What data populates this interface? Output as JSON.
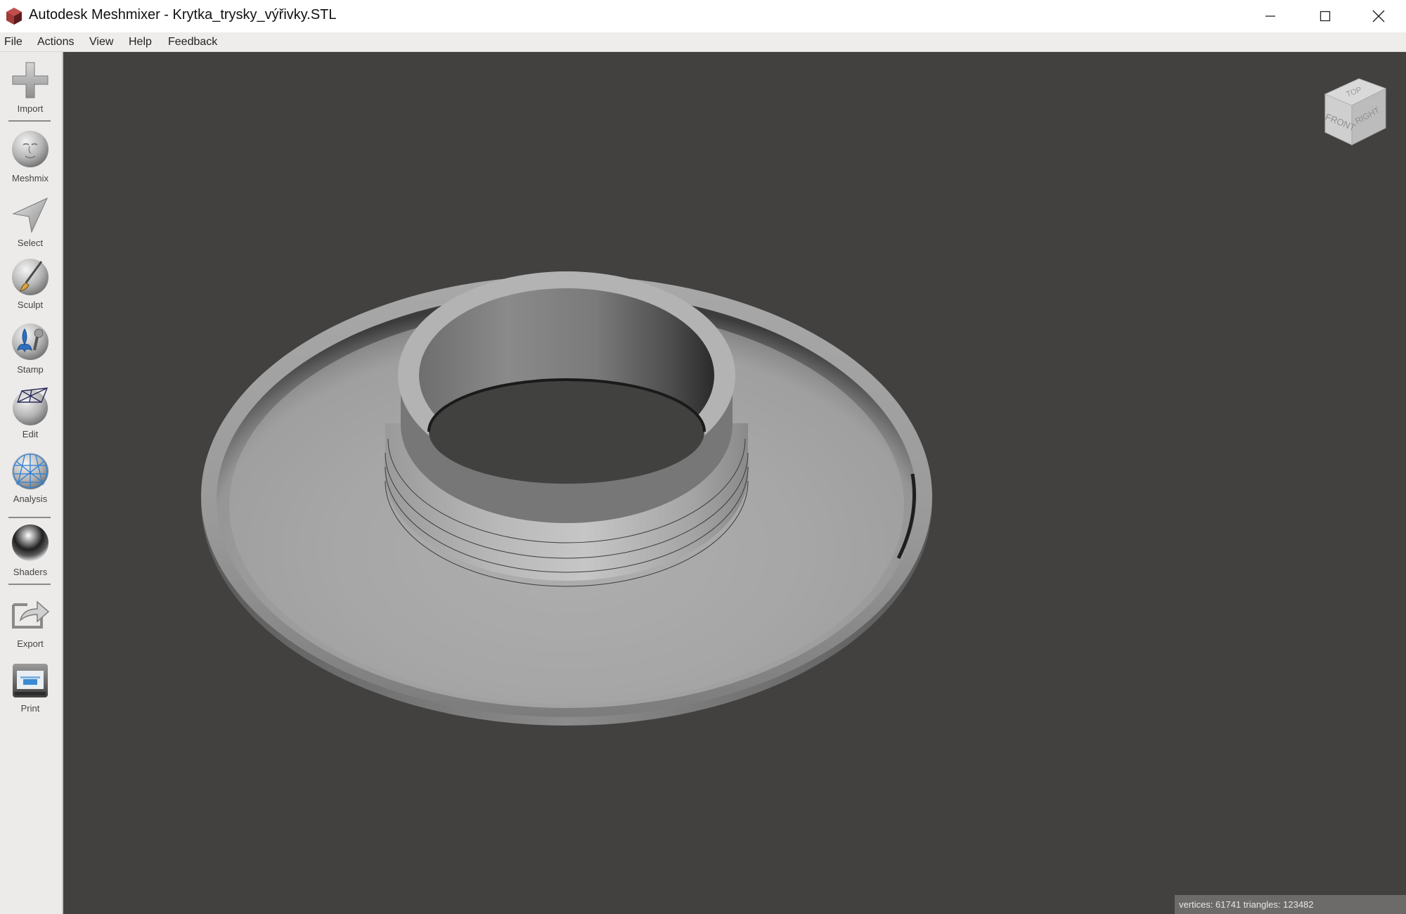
{
  "window": {
    "title": "Autodesk Meshmixer - Krytka_trysky_výřivky.STL",
    "controls": {
      "minimize": "minimize-icon",
      "maximize": "maximize-icon",
      "close": "close-icon"
    }
  },
  "menu": {
    "items": [
      {
        "label": "File"
      },
      {
        "label": "Actions"
      },
      {
        "label": "View"
      },
      {
        "label": "Help"
      },
      {
        "label": "Feedback"
      }
    ]
  },
  "toolbar": {
    "tools": [
      {
        "label": "Import",
        "icon": "plus-icon"
      },
      {
        "label": "Meshmix",
        "icon": "face-sphere-icon"
      },
      {
        "label": "Select",
        "icon": "arrow-pointer-icon"
      },
      {
        "label": "Sculpt",
        "icon": "brush-sphere-icon"
      },
      {
        "label": "Stamp",
        "icon": "fleur-de-lis-sphere-icon"
      },
      {
        "label": "Edit",
        "icon": "wireframe-sphere-icon"
      },
      {
        "label": "Analysis",
        "icon": "mesh-sphere-icon"
      },
      {
        "label": "Shaders",
        "icon": "chrome-sphere-icon"
      },
      {
        "label": "Export",
        "icon": "export-icon"
      },
      {
        "label": "Print",
        "icon": "printer-icon"
      }
    ]
  },
  "viewcube": {
    "faces": {
      "top": "TOP",
      "front": "FRONT",
      "right": "RIGHT"
    }
  },
  "status": {
    "text": "vertices: 61741 triangles: 123482"
  },
  "colors": {
    "viewport_background": "#424140",
    "toolbar_background": "#edebe9",
    "model_gray": "#a9a9a9"
  }
}
